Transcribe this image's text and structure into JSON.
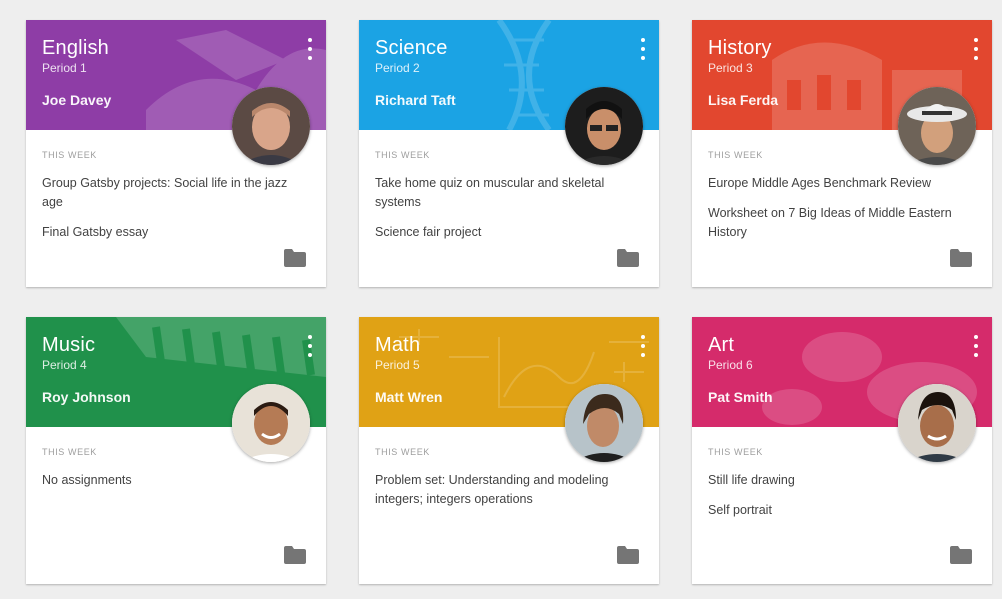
{
  "section_label": "THIS WEEK",
  "cards": [
    {
      "title": "English",
      "period": "Period 1",
      "teacher": "Joe Davey",
      "color": "#8e3da6",
      "assignments": [
        "Group Gatsby projects: Social life in the jazz age",
        "Final Gatsby essay"
      ]
    },
    {
      "title": "Science",
      "period": "Period 2",
      "teacher": "Richard Taft",
      "color": "#1ba3e4",
      "assignments": [
        "Take home quiz on muscular and skeletal systems",
        "Science fair project"
      ]
    },
    {
      "title": "History",
      "period": "Period 3",
      "teacher": "Lisa Ferda",
      "color": "#e2472f",
      "assignments": [
        "Europe Middle Ages Benchmark Review",
        "Worksheet on 7 Big Ideas of Middle Eastern History"
      ]
    },
    {
      "title": "Music",
      "period": "Period 4",
      "teacher": "Roy Johnson",
      "color": "#20914b",
      "assignments": [
        "No assignments"
      ]
    },
    {
      "title": "Math",
      "period": "Period 5",
      "teacher": "Matt Wren",
      "color": "#e0a215",
      "assignments": [
        "Problem set: Understanding and modeling integers; integers operations"
      ]
    },
    {
      "title": "Art",
      "period": "Period 6",
      "teacher": "Pat Smith",
      "color": "#d52b6b",
      "assignments": [
        "Still life drawing",
        "Self portrait"
      ]
    }
  ]
}
